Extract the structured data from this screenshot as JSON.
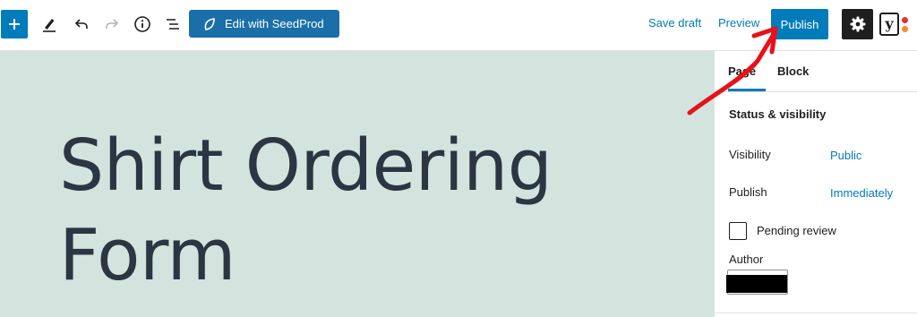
{
  "toolbar": {
    "seedprod_label": "Edit with SeedProd",
    "save_draft": "Save draft",
    "preview": "Preview",
    "publish": "Publish",
    "yoast_letter": "y"
  },
  "colors": {
    "accent": "#007cba",
    "canvas_bg": "#d3e4df",
    "title_text": "#2b3642",
    "annotation_arrow": "#e8101a",
    "yoast_dot_top": "#e5332a",
    "yoast_dot_bottom": "#f18d2d"
  },
  "icons": [
    "plus-icon",
    "pen-icon",
    "undo-icon",
    "redo-icon",
    "info-icon",
    "list-view-icon",
    "seedprod-leaf-icon",
    "gear-icon",
    "yoast-icon"
  ],
  "editor": {
    "title": "Shirt Ordering Form"
  },
  "sidebar": {
    "tabs": [
      {
        "label": "Page",
        "active": true
      },
      {
        "label": "Block",
        "active": false
      }
    ],
    "section_title": "Status & visibility",
    "rows": [
      {
        "label": "Visibility",
        "value": "Public"
      },
      {
        "label": "Publish",
        "value": "Immediately"
      }
    ],
    "pending_review": {
      "label": "Pending review",
      "checked": false
    },
    "author_label": "Author"
  }
}
